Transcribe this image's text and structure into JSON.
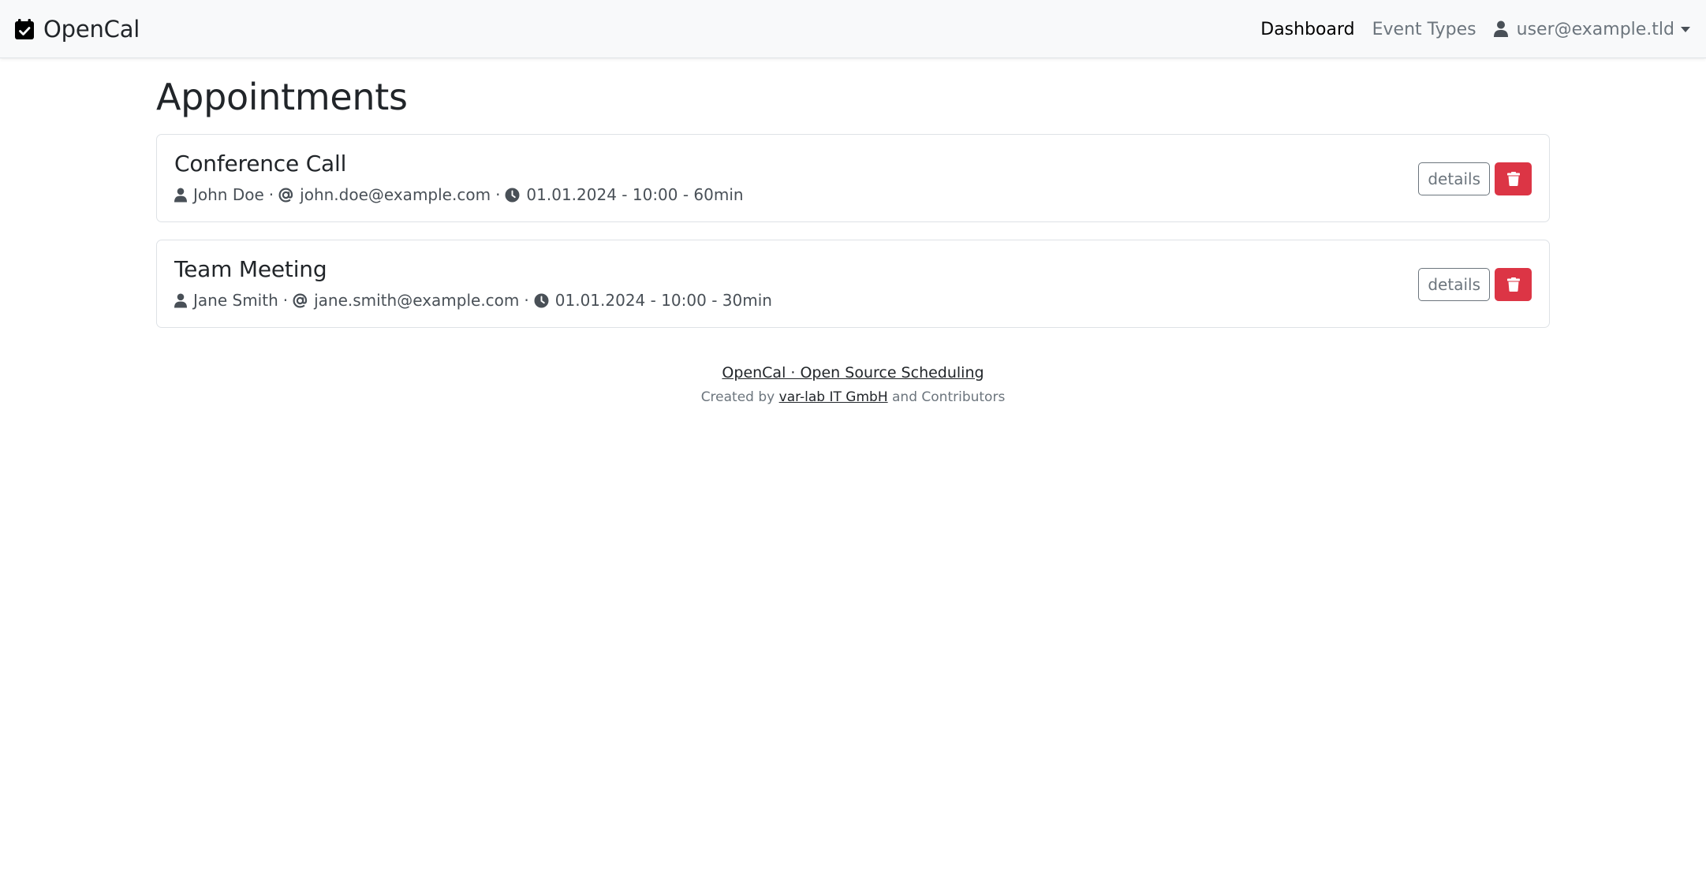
{
  "navbar": {
    "brand": "OpenCal",
    "brand_icon": "calendar-check-icon",
    "links": [
      {
        "label": "Dashboard",
        "active": true
      },
      {
        "label": "Event Types",
        "active": false
      }
    ],
    "user": {
      "label": "user@example.tld",
      "icon": "user-icon"
    }
  },
  "page": {
    "title": "Appointments"
  },
  "appointments": [
    {
      "title": "Conference Call",
      "name": "John Doe",
      "email": "john.doe@example.com",
      "schedule": "01.01.2024 - 10:00 - 60min",
      "details_label": "details",
      "delete_icon": "trash-icon"
    },
    {
      "title": "Team Meeting",
      "name": "Jane Smith",
      "email": "jane.smith@example.com",
      "schedule": "01.01.2024 - 10:00 - 30min",
      "details_label": "details",
      "delete_icon": "trash-icon"
    }
  ],
  "separator": "·",
  "footer": {
    "main_link": "OpenCal · Open Source Scheduling",
    "credit_prefix": "Created by",
    "credit_link": "var-lab IT GmbH",
    "credit_suffix": "and Contributors"
  },
  "colors": {
    "navbar_bg": "#f8f9fa",
    "danger": "#dc3545",
    "secondary": "#6c757d",
    "text": "#212529"
  }
}
